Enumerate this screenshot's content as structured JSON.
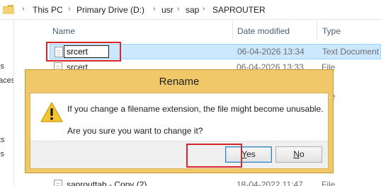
{
  "address_bar": {
    "crumbs": [
      "This PC",
      "Primary Drive (D:)",
      "usr",
      "sap",
      "SAPROUTER"
    ]
  },
  "left_nav": {
    "fragments": [
      "ls",
      "aces",
      "ts",
      "ls"
    ]
  },
  "columns": {
    "name": "Name",
    "date_modified": "Date modified",
    "type": "Type"
  },
  "files": [
    {
      "name": "srcert",
      "date": "06-04-2026 13:34",
      "type": "Text Document",
      "state": "renaming"
    },
    {
      "name": "srcert",
      "date": "06-04-2026 13:33",
      "type": "File"
    },
    {
      "name": "",
      "date": "",
      "type": "File"
    },
    {
      "name": "saprouttab - Copy (2)",
      "date": "18-04-2022 11:47",
      "type": "File"
    }
  ],
  "dialog": {
    "title": "Rename",
    "message_line1": "If you change a filename extension, the file might become unusable.",
    "message_line2": "Are you sure you want to change it?",
    "yes_label": "es",
    "yes_accel": "Y",
    "no_label": "o",
    "no_accel": "N",
    "icon": "warning-icon"
  },
  "colors": {
    "dialog_frame": "#f0c86a",
    "selection": "#cce8ff",
    "highlight_box": "#d9262c"
  }
}
